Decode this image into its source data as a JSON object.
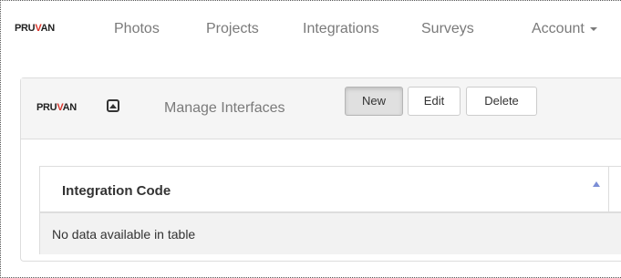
{
  "navbar": {
    "brand_prefix": "PRU",
    "brand_check": "V",
    "brand_suffix": "AN",
    "items": [
      {
        "label": "Photos"
      },
      {
        "label": "Projects"
      },
      {
        "label": "Integrations"
      },
      {
        "label": "Surveys"
      },
      {
        "label": "Account"
      }
    ]
  },
  "panel": {
    "brand_prefix": "PRU",
    "brand_check": "V",
    "brand_suffix": "AN",
    "title": "Manage Interfaces",
    "buttons": {
      "new": "New",
      "edit": "Edit",
      "delete": "Delete"
    }
  },
  "table": {
    "columns": [
      "Integration Code"
    ],
    "sort_direction": "ascending",
    "empty_message": "No data available in table"
  },
  "colors": {
    "brand_accent": "#d9342b",
    "sort_icon": "#7b8ed6"
  },
  "icons": {
    "collapse": "collapse-up-icon",
    "sort": "sort-ascending-icon",
    "account_dropdown": "caret-down-icon"
  }
}
